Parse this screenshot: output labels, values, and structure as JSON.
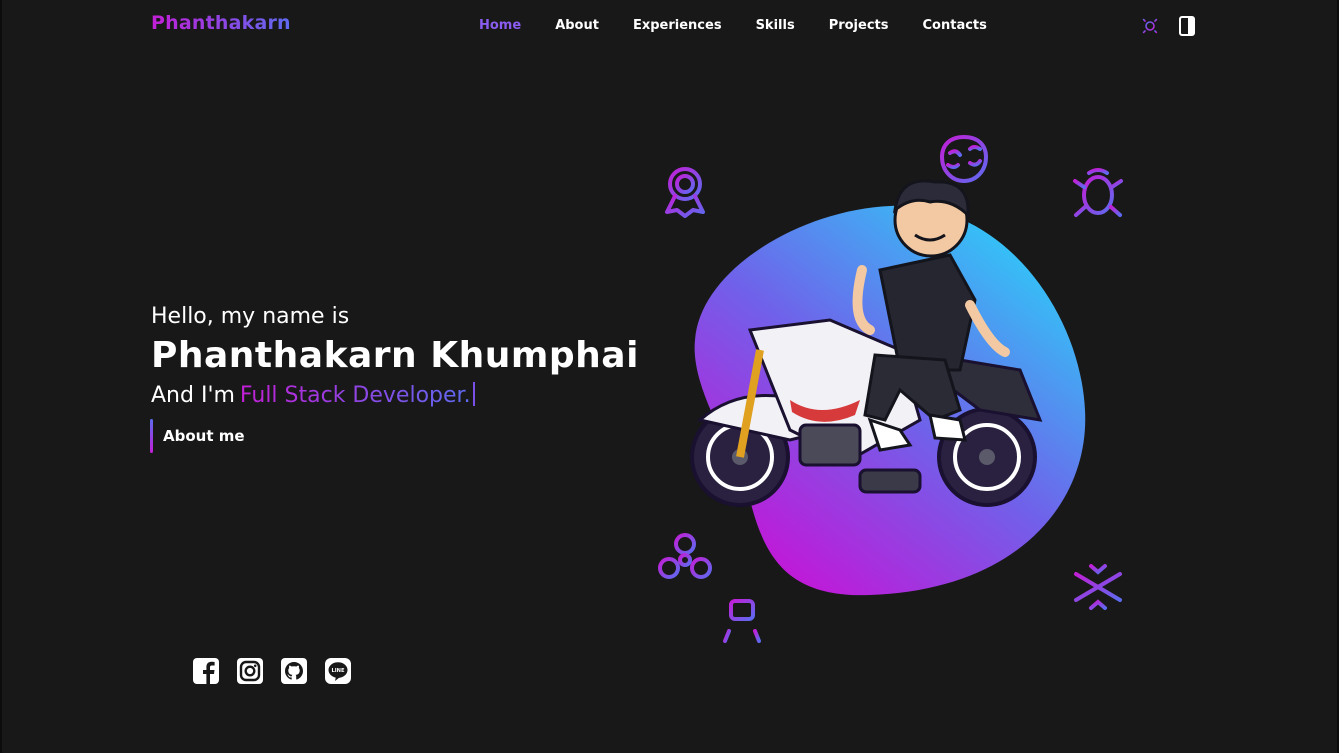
{
  "header": {
    "logo": "Phanthakarn",
    "nav": [
      {
        "label": "Home",
        "active": true
      },
      {
        "label": "About",
        "active": false
      },
      {
        "label": "Experiences",
        "active": false
      },
      {
        "label": "Skills",
        "active": false
      },
      {
        "label": "Projects",
        "active": false
      },
      {
        "label": "Contacts",
        "active": false
      }
    ],
    "icons": [
      "sun-icon",
      "book-icon"
    ]
  },
  "hero": {
    "greeting": "Hello, my name is",
    "name": "Phanthakarn Khumphai",
    "role_prefix": "And I'm",
    "role_typed": "Full Stack Developer.",
    "cta": "About me"
  },
  "illustration": {
    "subject": "cartoon-avatar-on-motorcycle",
    "floating_icons": [
      "award-ribbon-icon",
      "brain-icon",
      "bug-icon",
      "fidget-spinner-icon",
      "jackhammer-icon",
      "snowflake-icon"
    ]
  },
  "socials": [
    "facebook-icon",
    "instagram-icon",
    "github-icon",
    "line-icon"
  ],
  "colors": {
    "background": "#181818",
    "accent_pink": "#c21fd6",
    "accent_blue": "#5d6bf0",
    "accent_cyan": "#2fc8f7",
    "text": "#ffffff"
  }
}
